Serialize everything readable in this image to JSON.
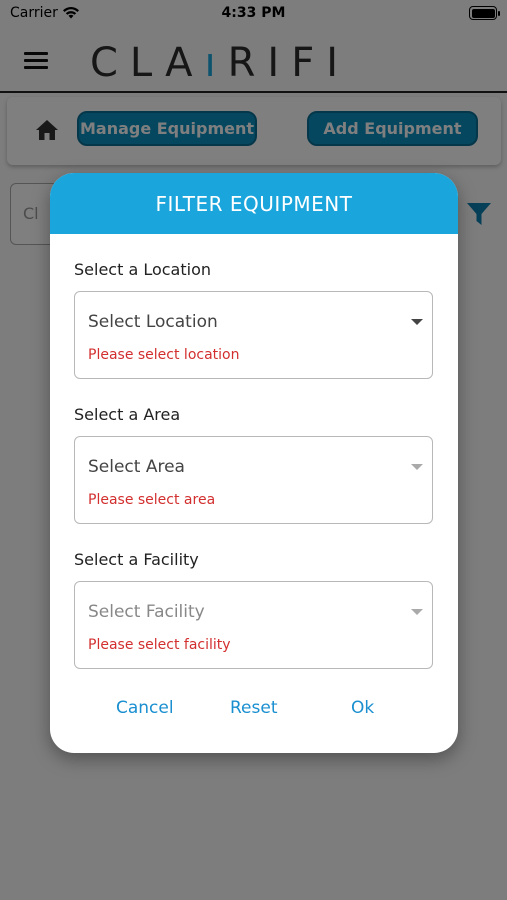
{
  "status_bar": {
    "carrier": "Carrier",
    "time": "4:33 PM"
  },
  "header": {
    "logo_part1": "CLA",
    "logo_accent": "ı",
    "logo_part2": "RIFI"
  },
  "toolbar": {
    "manage_label": "Manage Equipment",
    "add_label": "Add Equipment"
  },
  "search": {
    "placeholder_visible": "Cl"
  },
  "dialog": {
    "title": "FILTER EQUIPMENT",
    "fields": [
      {
        "label": "Select a Location",
        "value": "Select Location",
        "error": "Please select location"
      },
      {
        "label": "Select a Area",
        "value": "Select Area",
        "error": "Please select area"
      },
      {
        "label": "Select a Facility",
        "value": "Select Facility",
        "error": "Please select facility"
      }
    ],
    "actions": {
      "cancel": "Cancel",
      "reset": "Reset",
      "ok": "Ok"
    }
  },
  "colors": {
    "accent": "#1aa6dd",
    "button": "#0d8fc0",
    "error": "#d32f2f",
    "link": "#1a8fd0"
  },
  "icons": [
    "wifi-icon",
    "battery-icon",
    "menu-icon",
    "home-icon",
    "filter-icon",
    "chevron-down-icon"
  ]
}
